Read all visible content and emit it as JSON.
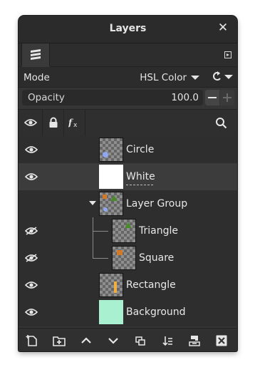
{
  "window": {
    "title": "Layers"
  },
  "tabs": [
    {
      "icon": "layers-stack-icon"
    }
  ],
  "mode": {
    "label": "Mode",
    "value": "HSL Color"
  },
  "opacity": {
    "label": "Opacity",
    "value": "100.0"
  },
  "header_icons": [
    "visibility-eye-icon",
    "lock-icon",
    "effects-fx-icon",
    "search-icon"
  ],
  "layers": [
    {
      "name": "Circle",
      "visible": true,
      "thumbnail": "circle-on-transparent"
    },
    {
      "name": "White",
      "visible": true,
      "thumbnail": "white-fill",
      "selected": true
    },
    {
      "name": "Layer Group",
      "visible": false,
      "thumbnail": "group-content",
      "expanded": true
    },
    {
      "name": "Triangle",
      "visible": true,
      "indent": 1,
      "thumbnail": "triangle-on-transparent"
    },
    {
      "name": "Square",
      "visible": true,
      "indent": 1,
      "thumbnail": "square-on-transparent"
    },
    {
      "name": "Rectangle",
      "visible": true,
      "thumbnail": "rectangle-on-transparent"
    },
    {
      "name": "Background",
      "visible": true,
      "thumbnail": "mint-fill"
    }
  ],
  "bottom_toolbar": [
    "new-layer-icon",
    "new-layer-group-icon",
    "raise-layer-icon",
    "lower-layer-icon",
    "duplicate-layer-icon",
    "merge-down-icon",
    "anchor-mask-icon",
    "delete-layer-icon"
  ],
  "colors": {
    "background_layer": "#a8f0d0",
    "circle_fill": "#8fa6f0",
    "triangle_fill": "#4a8a2a",
    "square_fill": "#d07a2a",
    "rectangle_fill": "#f0b040"
  }
}
